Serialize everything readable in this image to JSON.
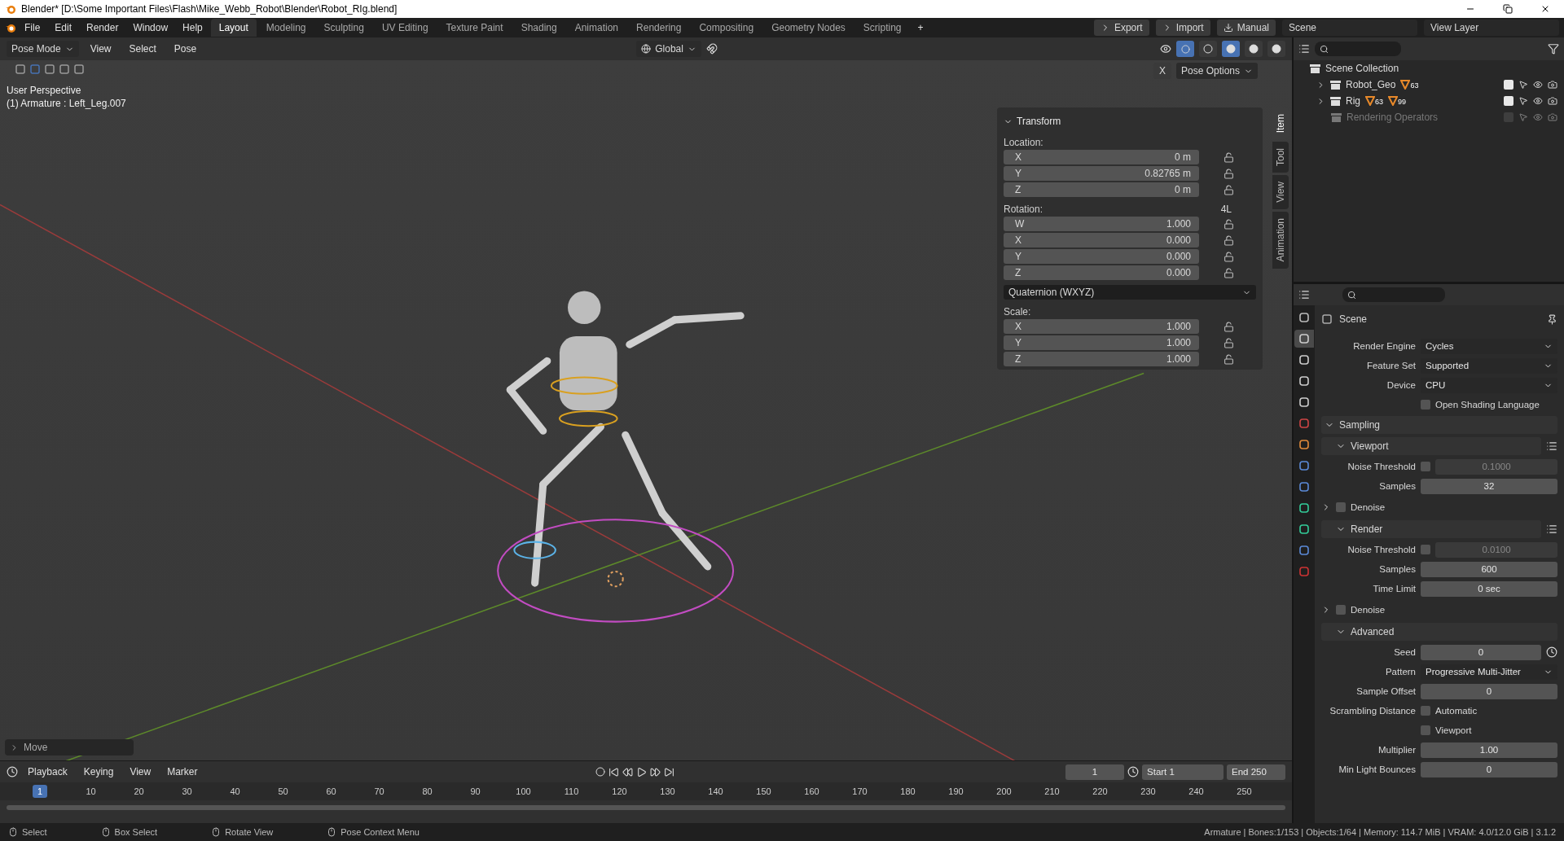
{
  "window": {
    "title": "Blender* [D:\\Some Important Files\\Flash\\Mike_Webb_Robot\\Blender\\Robot_RIg.blend]"
  },
  "menu": [
    "File",
    "Edit",
    "Render",
    "Window",
    "Help"
  ],
  "workspaces": [
    {
      "label": "Layout",
      "selected": true
    },
    {
      "label": "Modeling",
      "selected": false
    },
    {
      "label": "Sculpting",
      "selected": false
    },
    {
      "label": "UV Editing",
      "selected": false
    },
    {
      "label": "Texture Paint",
      "selected": false
    },
    {
      "label": "Shading",
      "selected": false
    },
    {
      "label": "Animation",
      "selected": false
    },
    {
      "label": "Rendering",
      "selected": false
    },
    {
      "label": "Compositing",
      "selected": false
    },
    {
      "label": "Geometry Nodes",
      "selected": false
    },
    {
      "label": "Scripting",
      "selected": false
    }
  ],
  "add_workspace": "+",
  "header_buttons": [
    "Export",
    "Import",
    "Manual"
  ],
  "scene": "Scene",
  "view_layer": "View Layer",
  "viewport_header": {
    "mode": "Pose Mode",
    "menus": [
      "View",
      "Select",
      "Pose"
    ],
    "orientation": "Global",
    "x_mirror": "X",
    "pose_options": "Pose Options"
  },
  "shading_modes": [
    {
      "selected": false
    },
    {
      "selected": true
    },
    {
      "selected": false
    },
    {
      "selected": false
    }
  ],
  "viewport": {
    "perspective": "User Perspective",
    "active": "(1) Armature : Left_Leg.007",
    "last_operator": "Move"
  },
  "transform": {
    "title": "Transform",
    "location_label": "Location:",
    "location": [
      {
        "axis": "X",
        "value": "0 m"
      },
      {
        "axis": "Y",
        "value": "0.82765 m"
      },
      {
        "axis": "Z",
        "value": "0 m"
      }
    ],
    "rotation_label": "Rotation:",
    "rotation_tag": "4L",
    "rotation": [
      {
        "axis": "W",
        "value": "1.000"
      },
      {
        "axis": "X",
        "value": "0.000"
      },
      {
        "axis": "Y",
        "value": "0.000"
      },
      {
        "axis": "Z",
        "value": "0.000"
      }
    ],
    "rotation_mode": "Quaternion (WXYZ)",
    "scale_label": "Scale:",
    "scale": [
      {
        "axis": "X",
        "value": "1.000"
      },
      {
        "axis": "Y",
        "value": "1.000"
      },
      {
        "axis": "Z",
        "value": "1.000"
      }
    ]
  },
  "sidebar_tabs": [
    {
      "label": "Item",
      "selected": true
    },
    {
      "label": "Tool",
      "selected": false
    },
    {
      "label": "View",
      "selected": false
    },
    {
      "label": "Animation",
      "selected": false
    }
  ],
  "outliner": {
    "root": "Scene Collection",
    "children": [
      {
        "name": "Robot_Geo",
        "badges": [
          "63"
        ],
        "checked": true,
        "disabled": false
      },
      {
        "name": "Rig",
        "badges": [
          "63",
          "99"
        ],
        "checked": true,
        "disabled": false
      },
      {
        "name": "Rendering Operators",
        "checked": false,
        "disabled": true
      }
    ]
  },
  "property_tabs": [
    {
      "selected": false
    },
    {
      "selected": true
    },
    {
      "selected": false
    },
    {
      "selected": false
    },
    {
      "selected": false
    },
    {
      "selected": false
    },
    {
      "selected": false
    },
    {
      "selected": false
    },
    {
      "selected": false
    },
    {
      "selected": false
    },
    {
      "selected": false
    },
    {
      "selected": false
    },
    {
      "selected": false
    }
  ],
  "properties": {
    "context": "Scene",
    "rows": [
      {
        "kind": "select",
        "label": "Render Engine",
        "value": "Cycles"
      },
      {
        "kind": "select",
        "label": "Feature Set",
        "value": "Supported"
      },
      {
        "kind": "select",
        "label": "Device",
        "value": "CPU"
      },
      {
        "kind": "check",
        "label": "",
        "text": "Open Shading Language",
        "checked": false
      },
      {
        "kind": "panel",
        "label": "Sampling",
        "expanded": true
      },
      {
        "kind": "subpanel",
        "label": "Viewport",
        "expanded": true,
        "presets": true
      },
      {
        "kind": "toggle_number",
        "label": "Noise Threshold",
        "value": "0.1000",
        "checked": false
      },
      {
        "kind": "number",
        "label": "Samples",
        "value": "32"
      },
      {
        "kind": "check_subpanel",
        "label": "Denoise",
        "checked": false,
        "expanded": false
      },
      {
        "kind": "subpanel",
        "label": "Render",
        "expanded": true,
        "presets": true
      },
      {
        "kind": "toggle_number",
        "label": "Noise Threshold",
        "value": "0.0100",
        "checked": false
      },
      {
        "kind": "number",
        "label": "Samples",
        "value": "600"
      },
      {
        "kind": "number",
        "label": "Time Limit",
        "value": "0 sec"
      },
      {
        "kind": "check_subpanel",
        "label": "Denoise",
        "checked": false,
        "expanded": false
      },
      {
        "kind": "subpanel",
        "label": "Advanced",
        "expanded": true,
        "presets": false
      },
      {
        "kind": "seed",
        "label": "Seed",
        "value": "0"
      },
      {
        "kind": "select",
        "label": "Pattern",
        "value": "Progressive Multi-Jitter"
      },
      {
        "kind": "number",
        "label": "Sample Offset",
        "value": "0"
      },
      {
        "kind": "check",
        "label": "Scrambling Distance",
        "text": "Automatic",
        "checked": false
      },
      {
        "kind": "check",
        "label": "",
        "text": "Viewport",
        "checked": false
      },
      {
        "kind": "number",
        "label": "Multiplier",
        "value": "1.00"
      },
      {
        "kind": "number",
        "label": "Min Light Bounces",
        "value": "0"
      }
    ]
  },
  "timeline": {
    "menus": [
      "Playback",
      "Keying",
      "View",
      "Marker"
    ],
    "frame": "1",
    "start_label": "Start",
    "start": "1",
    "end_label": "End",
    "end": "250",
    "current_frame": "1",
    "ruler": [
      "10",
      "20",
      "30",
      "40",
      "50",
      "60",
      "70",
      "80",
      "90",
      "100",
      "110",
      "120",
      "130",
      "140",
      "150",
      "160",
      "170",
      "180",
      "190",
      "200",
      "210",
      "220",
      "230",
      "240",
      "250"
    ]
  },
  "status_bar": {
    "hints": [
      "Select",
      "Box Select",
      "Rotate View",
      "Pose Context Menu"
    ],
    "stats": "Armature | Bones:1/153 | Objects:1/64 | Memory: 114.7 MiB | VRAM: 4.0/12.0 GiB | 3.1.2"
  }
}
